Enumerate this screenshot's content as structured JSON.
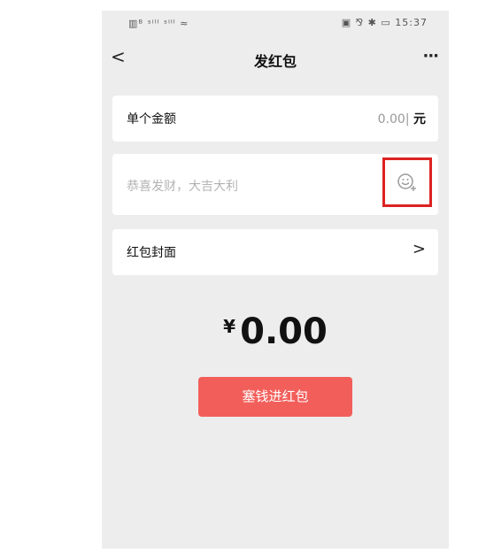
{
  "statusbar": {
    "left": "▥ᴮ ˢⁱˡˡ ˢⁱˡˡ ≈",
    "right": "▣ ⅋ ✱ ▭ 15:37"
  },
  "navbar": {
    "back": "<",
    "title": "发红包",
    "more": "···"
  },
  "amount_row": {
    "label": "单个金额",
    "value": "0.00",
    "unit": "元"
  },
  "greeting_row": {
    "placeholder": "恭喜发财，大吉大利",
    "emoji_icon": "emoji-add-icon"
  },
  "cover_row": {
    "label": "红包封面",
    "chevron": ">"
  },
  "total": {
    "currency": "¥",
    "amount": "0.00"
  },
  "send_button": {
    "label": "塞钱进红包"
  },
  "colors": {
    "background": "#ededed",
    "accent": "#f25f5b",
    "highlight": "#dd2222"
  }
}
